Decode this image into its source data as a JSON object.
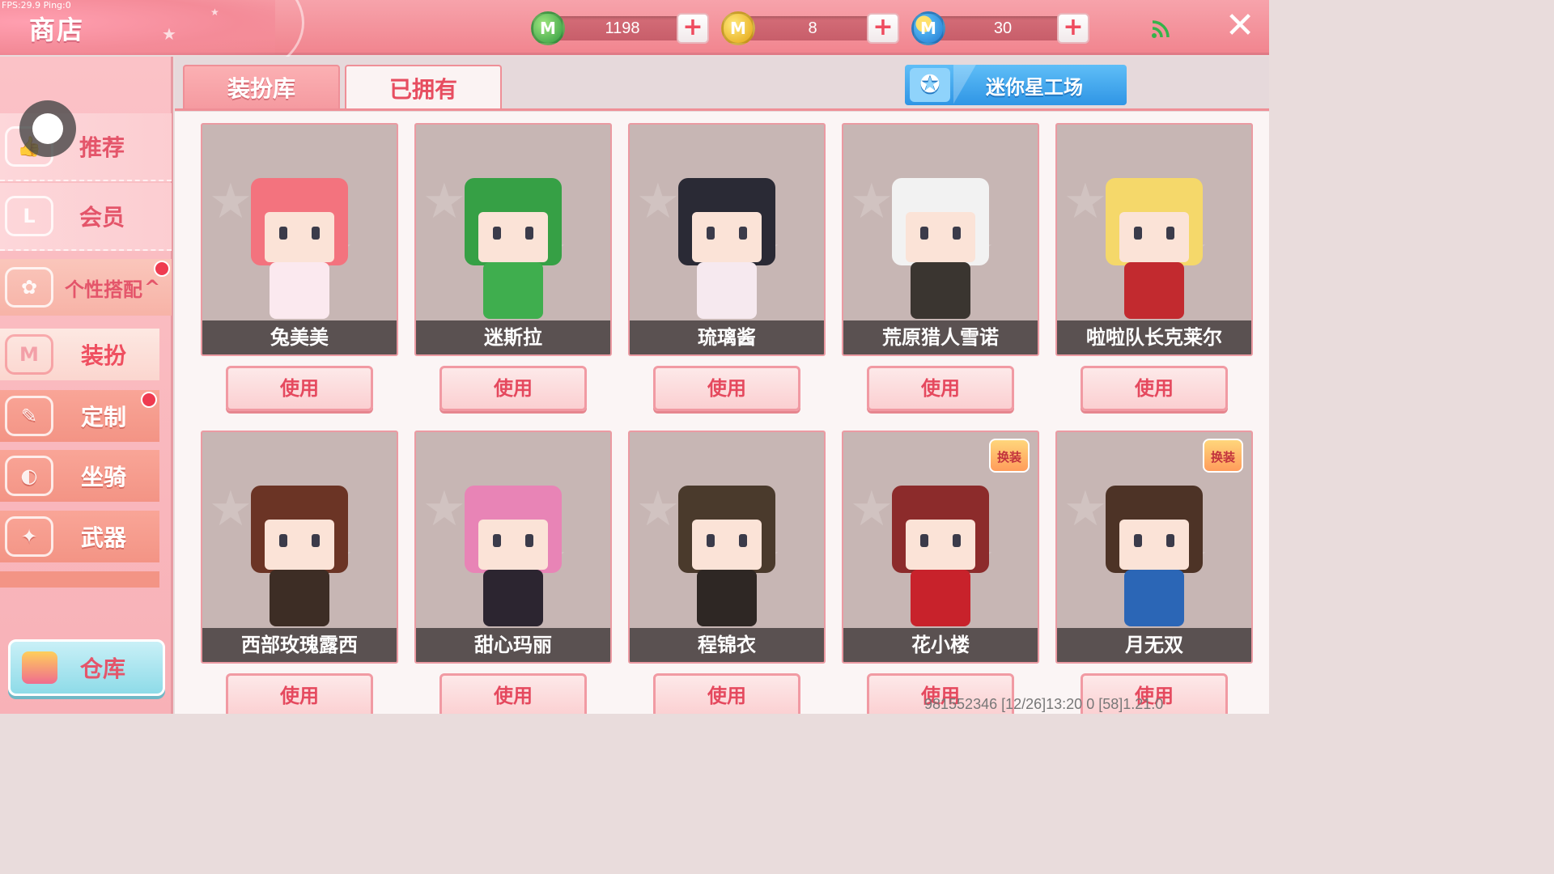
{
  "debug": {
    "fps_text": "FPS:29.9  Ping:0"
  },
  "header": {
    "title": "商店"
  },
  "currencies": [
    {
      "icon": "mini-bean-icon",
      "symbol": "M",
      "value": "1198"
    },
    {
      "icon": "mini-coin-icon",
      "symbol": "M",
      "value": "8"
    },
    {
      "icon": "mini-point-icon",
      "symbol": "M",
      "value": "30"
    }
  ],
  "sidebar": {
    "items": [
      {
        "label": "推荐",
        "icon": "thumbs-up-icon",
        "glyph": "👍"
      },
      {
        "label": "会员",
        "icon": "vip-icon",
        "glyph": "L"
      },
      {
        "label": "个性搭配",
        "icon": "style-icon",
        "glyph": "✿",
        "arrow": "^"
      },
      {
        "label": "装扮",
        "icon": "shirt-icon",
        "glyph": "M"
      },
      {
        "label": "定制",
        "icon": "pencil-icon",
        "glyph": "✎"
      },
      {
        "label": "坐骑",
        "icon": "mount-icon",
        "glyph": "◐"
      },
      {
        "label": "武器",
        "icon": "gun-icon",
        "glyph": "✦"
      }
    ],
    "warehouse_label": "仓库"
  },
  "tabs": [
    {
      "label": "装扮库",
      "active": false
    },
    {
      "label": "已拥有",
      "active": true
    }
  ],
  "workshop_label": "迷你星工场",
  "cards": [
    {
      "name": "兔美美",
      "button": "使用",
      "hair": "#f3737e",
      "body": "#fbe9ef",
      "exchange": false
    },
    {
      "name": "迷斯拉",
      "button": "使用",
      "hair": "#36a045",
      "body": "#3fae4e",
      "exchange": false
    },
    {
      "name": "琉璃酱",
      "button": "使用",
      "hair": "#2a2a35",
      "body": "#f6e9ef",
      "exchange": false
    },
    {
      "name": "荒原猎人雪诺",
      "button": "使用",
      "hair": "#f2f2f2",
      "body": "#3a3530",
      "exchange": false
    },
    {
      "name": "啦啦队长克莱尔",
      "button": "使用",
      "hair": "#f5d86a",
      "body": "#c22a2f",
      "exchange": false
    },
    {
      "name": "西部玫瑰露西",
      "button": "使用",
      "hair": "#6b3425",
      "body": "#3d2d25",
      "exchange": false
    },
    {
      "name": "甜心玛丽",
      "button": "使用",
      "hair": "#e884b6",
      "body": "#2c2530",
      "exchange": false
    },
    {
      "name": "程锦衣",
      "button": "使用",
      "hair": "#4a3a2c",
      "body": "#2e2724",
      "exchange": false
    },
    {
      "name": "花小楼",
      "button": "使用",
      "hair": "#8c2b2b",
      "body": "#c8222b",
      "exchange": true
    },
    {
      "name": "月无双",
      "button": "使用",
      "hair": "#4d3326",
      "body": "#2b66b6",
      "exchange": true
    }
  ],
  "exchange_badge_text": "换装",
  "footer": {
    "info": "981552346    [12/26]13:20 0   [58]1.21.0"
  }
}
